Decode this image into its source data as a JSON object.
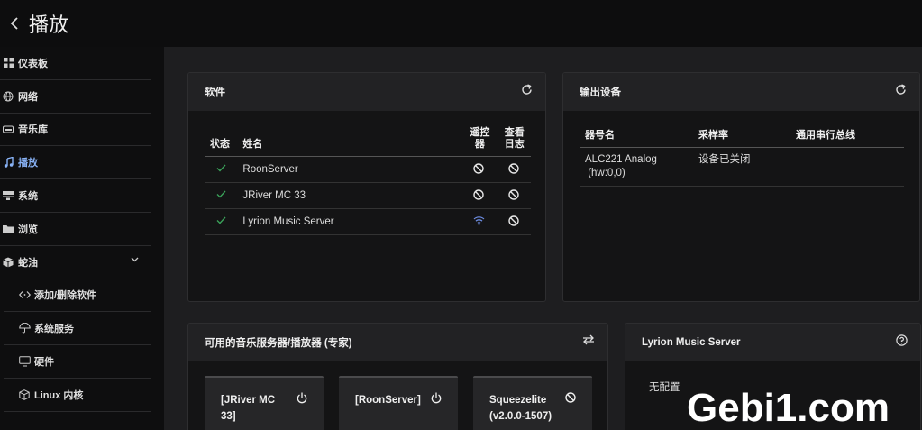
{
  "header": {
    "back_icon": "chevron-left-icon",
    "title": "播放"
  },
  "sidebar": {
    "items": [
      {
        "label": "仪表板",
        "icon": "dashboard-grid-icon"
      },
      {
        "label": "网络",
        "icon": "globe-icon"
      },
      {
        "label": "音乐库",
        "icon": "drive-icon"
      },
      {
        "label": "播放",
        "icon": "music-note-icon",
        "active": true
      },
      {
        "label": "系统",
        "icon": "server-icon"
      },
      {
        "label": "浏览",
        "icon": "folder-icon"
      },
      {
        "label": "蛇油",
        "icon": "box-icon",
        "expanded": true
      },
      {
        "label": "添加/删除软件",
        "icon": "code-icon"
      },
      {
        "label": "系统服务",
        "icon": "umbrella-icon"
      },
      {
        "label": "硬件",
        "icon": "monitor-icon"
      },
      {
        "label": "Linux 内核",
        "icon": "cube-icon"
      }
    ],
    "accent": "#8ab4f8"
  },
  "software": {
    "title": "软件",
    "headers": {
      "status": "状态",
      "name": "姓名",
      "remote1": "遥控",
      "remote2": "器",
      "log1": "查看",
      "log2": "日志"
    },
    "rows": [
      {
        "name": "RoonServer",
        "status": "check",
        "remote": "disabled-icon",
        "log": "disabled-icon"
      },
      {
        "name": "JRiver MC 33",
        "status": "check",
        "remote": "disabled-icon",
        "log": "disabled-icon"
      },
      {
        "name": "Lyrion Music Server",
        "status": "check",
        "remote": "wifi-icon",
        "log": "disabled-icon"
      }
    ]
  },
  "output": {
    "title": "输出设备",
    "headers": {
      "device": "器号名",
      "rate": "采样率",
      "usb": "通用串行总线"
    },
    "rows": [
      {
        "device_line1": "ALC221 Analog",
        "device_line2": "(hw:0,0)",
        "rate": "设备已关闭",
        "usb": ""
      }
    ]
  },
  "servers": {
    "title": "可用的音乐服务器/播放器 (专家)",
    "tiles": [
      {
        "line1": "[JRiver MC",
        "line2": "33]",
        "icon": "power-icon"
      },
      {
        "line1": "[RoonServer]",
        "line2": "",
        "icon": "power-icon"
      },
      {
        "line1": "Squeezelite",
        "line2": "(v2.0.0-1507)",
        "icon": "disabled-icon"
      }
    ]
  },
  "lyrion": {
    "title": "Lyrion Music Server",
    "body": "无配置"
  },
  "watermark": "Gebi1.com",
  "colors": {
    "check": "#3aa35a",
    "wifi": "#6f8fe6",
    "active": "#8ab4f8"
  }
}
